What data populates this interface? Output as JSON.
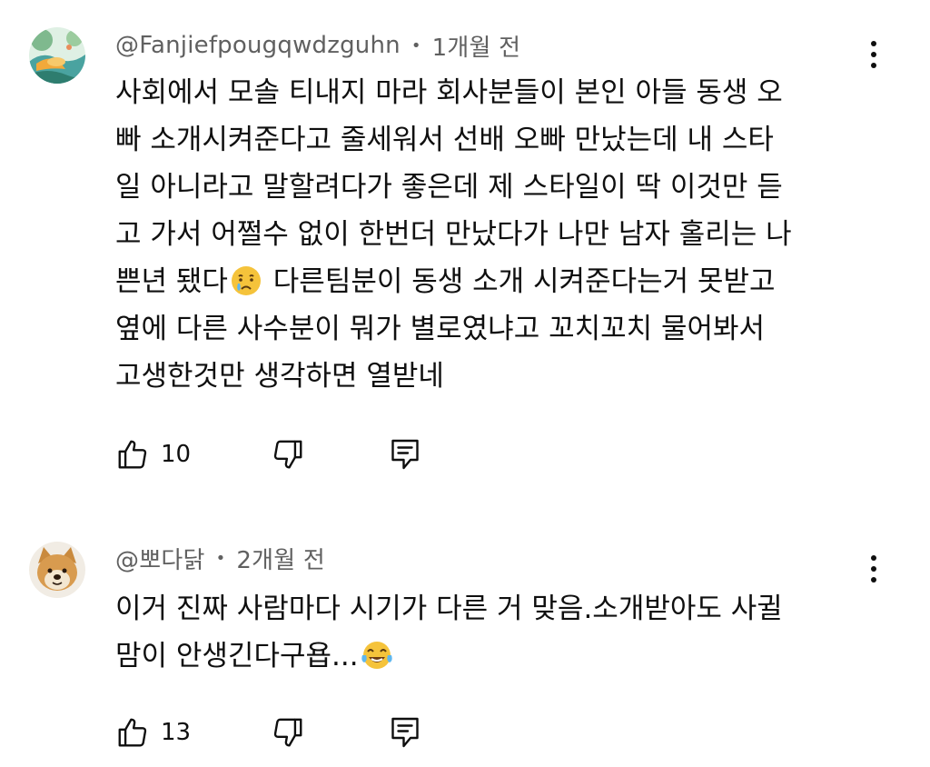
{
  "comments": [
    {
      "author": "@Fanjiefpougqwdzguhn",
      "separator": "•",
      "time": "1개월 전",
      "text_before_emoji": "사회에서 모솔 티내지 마라 회사분들이 본인 아들 동생 오\n빠 소개시켜준다고 줄세워서 선배 오빠 만났는데 내 스타\n일 아니라고 말할려다가 좋은데 제 스타일이 딱 이것만 듣\n고 가서 어쩔수 없이 한번더 만났다가 나만 남자 홀리는 나\n쁜년 됐다",
      "emoji": "crying-face",
      "text_after_emoji": " 다른팀분이 동생 소개 시켜준다는거 못받고\n옆에 다른 사수분이 뭐가 별로였냐고 꼬치꼬치 물어봐서\n고생한것만 생각하면 열받네",
      "likes": "10",
      "avatar": "landscape-avatar"
    },
    {
      "author": "@뽀다닭",
      "separator": "•",
      "time": "2개월 전",
      "text_before_emoji": "이거 진짜 사람마다 시기가 다른 거 맞음.소개받아도 사귈\n맘이 안생긴다구욥...",
      "emoji": "tears-of-joy",
      "text_after_emoji": "",
      "likes": "13",
      "avatar": "shiba-dog-avatar"
    }
  ],
  "colors": {
    "meta": "#606060",
    "text": "#0f0f0f",
    "emoji": "#f5c33b"
  }
}
